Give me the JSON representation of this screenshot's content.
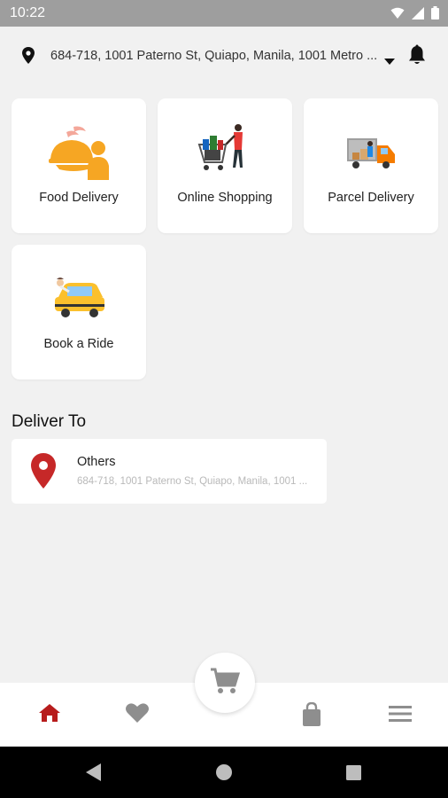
{
  "status_bar": {
    "time": "10:22"
  },
  "location": {
    "address": "684-718, 1001 Paterno St, Quiapo, Manila, 1001 Metro ..."
  },
  "services": [
    {
      "label": "Food Delivery"
    },
    {
      "label": "Online Shopping"
    },
    {
      "label": "Parcel Delivery"
    },
    {
      "label": "Book a Ride"
    }
  ],
  "deliver_to": {
    "title": "Deliver To",
    "name": "Others",
    "address": "684-718, 1001 Paterno St, Quiapo, Manila, 1001 ..."
  },
  "colors": {
    "accent": "#b71c1c",
    "pin": "#c62828",
    "nav_icon": "#8e8e8e",
    "food_orange": "#f6a623"
  },
  "icons": {
    "status": [
      "wifi-icon",
      "signal-icon",
      "battery-icon"
    ],
    "nav": [
      "home-icon",
      "heart-icon",
      "cart-icon",
      "bag-icon",
      "menu-icon"
    ],
    "system": [
      "back-icon",
      "home-circle-icon",
      "recents-icon"
    ]
  }
}
